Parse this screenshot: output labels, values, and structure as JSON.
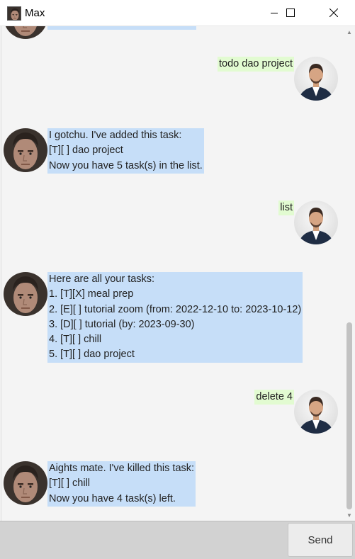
{
  "window": {
    "title": "Max"
  },
  "messages": [
    {
      "from": "bot",
      "text": ""
    },
    {
      "from": "user",
      "text": "todo dao project"
    },
    {
      "from": "bot",
      "text": "I gotchu. I've added this task:\n[T][ ] dao project\nNow you have 5 task(s) in the list."
    },
    {
      "from": "user",
      "text": "list"
    },
    {
      "from": "bot",
      "text": "Here are all your tasks:\n1. [T][X] meal prep\n2. [E][ ] tutorial zoom (from: 2022-12-10 to: 2023-10-12)\n3. [D][ ] tutorial (by: 2023-09-30)\n4. [T][ ] chill\n5. [T][ ] dao project"
    },
    {
      "from": "user",
      "text": "delete 4"
    },
    {
      "from": "bot",
      "text": "Aights mate. I've killed this task:\n[T][ ] chill\nNow you have 4 task(s) left."
    }
  ],
  "input": {
    "value": ""
  },
  "send_button": {
    "label": "Send"
  },
  "colors": {
    "bot_bubble": "#c6def8",
    "user_bubble": "#e2fbd1",
    "bottom_bar": "#d2d2d2"
  }
}
